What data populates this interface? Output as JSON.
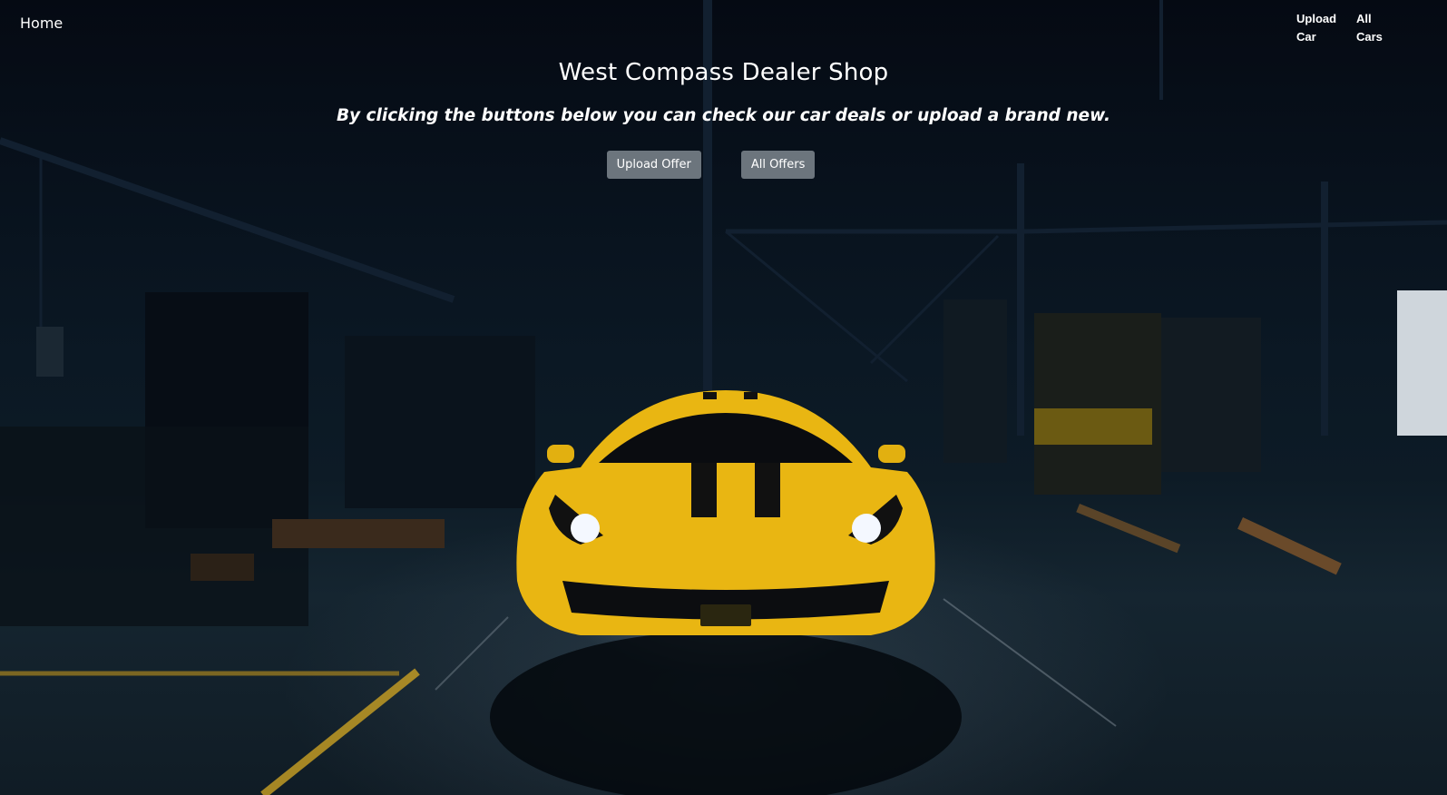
{
  "nav": {
    "home": "Home",
    "links": [
      "Upload Car",
      "All Cars"
    ]
  },
  "hero": {
    "title": "West Compass Dealer Shop",
    "subtitle": "By clicking the buttons below you can check our car deals or upload a brand new.",
    "buttons": [
      "Upload Offer",
      "All Offers"
    ]
  },
  "background": {
    "subject": "car-photo",
    "car_color": "#f2c21a",
    "base_color": "#0b1824"
  },
  "colors": {
    "button_bg": "#6c757d",
    "text": "#ffffff"
  }
}
